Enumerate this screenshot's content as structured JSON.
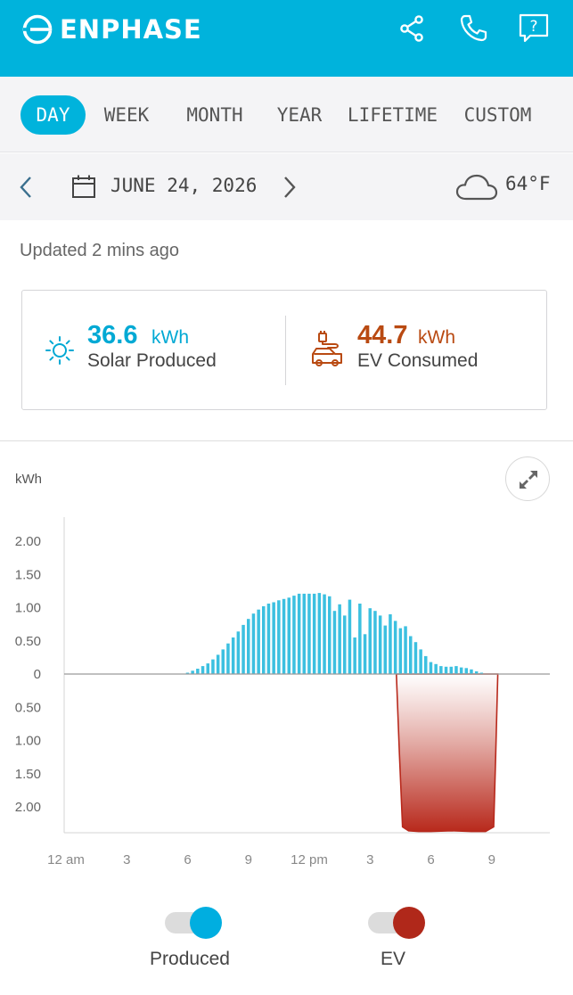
{
  "app": {
    "brand": "ENPHASE",
    "accent_color": "#00b3dc"
  },
  "header": {
    "icons": [
      "share-icon",
      "phone-icon",
      "help-icon"
    ],
    "help_glyph": "?"
  },
  "period_tabs": {
    "items": [
      "DAY",
      "WEEK",
      "MONTH",
      "YEAR",
      "LIFETIME",
      "CUSTOM"
    ],
    "selected": "DAY"
  },
  "date_nav": {
    "date": "JUNE 24, 2026",
    "temperature": "64°F",
    "weather_icon": "cloud-icon"
  },
  "status": {
    "updated": "Updated 2 mins ago"
  },
  "summary": {
    "solar": {
      "value": "36.6",
      "unit": "kWh",
      "label": "Solar Produced",
      "color": "#00a9d4",
      "icon": "sun-icon"
    },
    "ev": {
      "value": "44.7",
      "unit": "kWh",
      "label": "EV Consumed",
      "color": "#b94a12",
      "icon": "ev-charging-icon"
    }
  },
  "chart_data": {
    "type": "bar",
    "ylabel": "kWh",
    "y_ticks_positive": [
      "2.00",
      "1.50",
      "1.00",
      "0.50",
      "0"
    ],
    "y_ticks_negative": [
      "0.50",
      "1.00",
      "1.50",
      "2.00"
    ],
    "ylim": [
      -2.4,
      2.3
    ],
    "x_ticks": [
      "12 am",
      "3",
      "6",
      "9",
      "12 pm",
      "3",
      "6",
      "9"
    ],
    "x_domain_hours": [
      0,
      24
    ],
    "series": [
      {
        "name": "Produced",
        "color": "#3cc0e0",
        "interval_hours": 0.25,
        "start_hour": 6.0,
        "values": [
          0.02,
          0.05,
          0.08,
          0.12,
          0.16,
          0.22,
          0.29,
          0.37,
          0.46,
          0.55,
          0.64,
          0.74,
          0.83,
          0.91,
          0.97,
          1.02,
          1.06,
          1.08,
          1.11,
          1.13,
          1.15,
          1.18,
          1.21,
          1.21,
          1.21,
          1.21,
          1.22,
          1.2,
          1.17,
          0.95,
          1.05,
          0.88,
          1.12,
          0.55,
          1.06,
          0.6,
          0.99,
          0.95,
          0.88,
          0.73,
          0.9,
          0.8,
          0.69,
          0.72,
          0.57,
          0.48,
          0.37,
          0.27,
          0.18,
          0.15,
          0.12,
          0.11,
          0.11,
          0.12,
          0.1,
          0.09,
          0.07,
          0.04,
          0.02
        ]
      },
      {
        "name": "EV",
        "color": "#b8291c",
        "type": "area",
        "x_hours": [
          16.3,
          16.45,
          16.6,
          16.9,
          17.4,
          18.0,
          19.0,
          20.0,
          20.7,
          21.1,
          21.2,
          21.3
        ],
        "values": [
          0,
          -1.2,
          -2.3,
          -2.36,
          -2.37,
          -2.37,
          -2.36,
          -2.37,
          -2.37,
          -2.3,
          -1.2,
          0
        ]
      }
    ],
    "legend": {
      "position": "bottom"
    }
  },
  "legend_toggles": [
    {
      "label": "Produced",
      "color": "#00aee0",
      "on": true
    },
    {
      "label": "EV",
      "color": "#b0281a",
      "on": true
    }
  ]
}
